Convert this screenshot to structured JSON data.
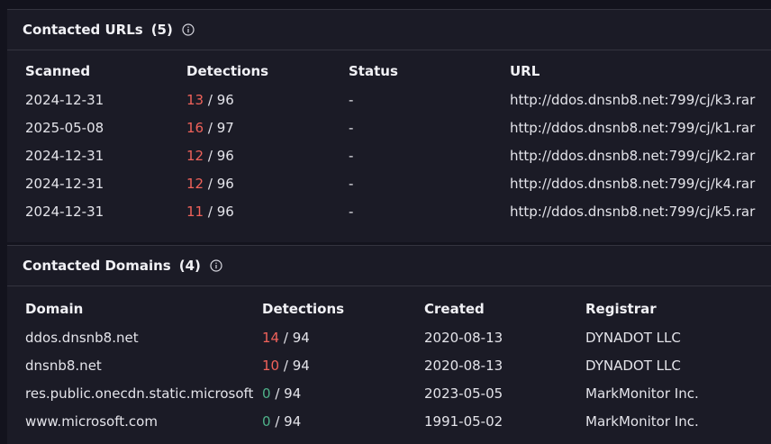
{
  "urls_section": {
    "title": "Contacted URLs",
    "count": "(5)",
    "columns": [
      "Scanned",
      "Detections",
      "Status",
      "URL"
    ],
    "rows": [
      {
        "scanned": "2024-12-31",
        "det_pos": "13",
        "det_total": "/ 96",
        "status": "-",
        "url": "http://ddos.dnsnb8.net:799/cj/k3.rar"
      },
      {
        "scanned": "2025-05-08",
        "det_pos": "16",
        "det_total": "/ 97",
        "status": "-",
        "url": "http://ddos.dnsnb8.net:799/cj/k1.rar"
      },
      {
        "scanned": "2024-12-31",
        "det_pos": "12",
        "det_total": "/ 96",
        "status": "-",
        "url": "http://ddos.dnsnb8.net:799/cj/k2.rar"
      },
      {
        "scanned": "2024-12-31",
        "det_pos": "12",
        "det_total": "/ 96",
        "status": "-",
        "url": "http://ddos.dnsnb8.net:799/cj/k4.rar"
      },
      {
        "scanned": "2024-12-31",
        "det_pos": "11",
        "det_total": "/ 96",
        "status": "-",
        "url": "http://ddos.dnsnb8.net:799/cj/k5.rar"
      }
    ]
  },
  "domains_section": {
    "title": "Contacted Domains",
    "count": "(4)",
    "columns": [
      "Domain",
      "Detections",
      "Created",
      "Registrar"
    ],
    "rows": [
      {
        "domain": "ddos.dnsnb8.net",
        "det_pos": "14",
        "det_total": "/ 94",
        "created": "2020-08-13",
        "registrar": "DYNADOT LLC"
      },
      {
        "domain": "dnsnb8.net",
        "det_pos": "10",
        "det_total": "/ 94",
        "created": "2020-08-13",
        "registrar": "DYNADOT LLC"
      },
      {
        "domain": "res.public.onecdn.static.microsoft",
        "det_pos": "0",
        "det_total": "/ 94",
        "created": "2023-05-05",
        "registrar": "MarkMonitor Inc."
      },
      {
        "domain": "www.microsoft.com",
        "det_pos": "0",
        "det_total": "/ 94",
        "created": "1991-05-02",
        "registrar": "MarkMonitor Inc."
      }
    ]
  },
  "icons": {
    "info": "info-icon"
  },
  "colors": {
    "background": "#13131d",
    "card": "#1b1b26",
    "positive_detection": "#f0625a",
    "zero_detection": "#4fb28a"
  }
}
